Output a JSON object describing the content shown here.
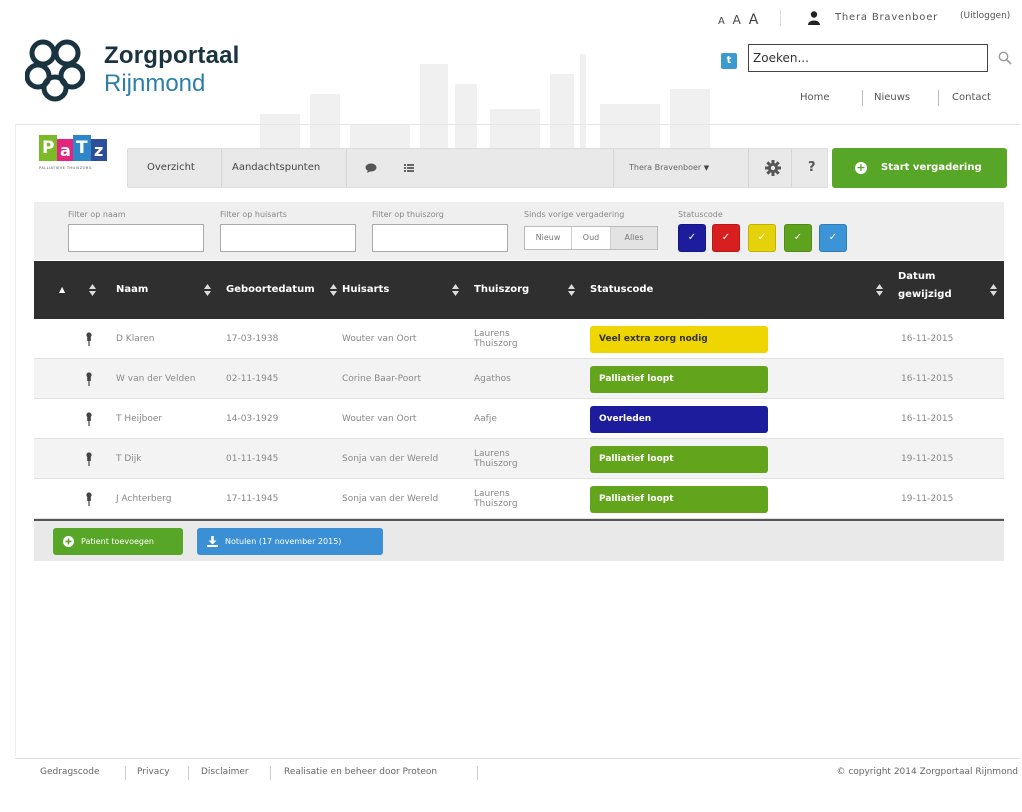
{
  "topbar": {
    "font_sizes": [
      "A",
      "A",
      "A"
    ],
    "user_name": "Thera Bravenboer",
    "logout": "(Uitloggen)"
  },
  "header": {
    "logo_title": "Zorgportaal",
    "logo_subtitle": "Rijnmond",
    "twitter_glyph": "t",
    "search_placeholder": "Zoeken...",
    "nav": [
      "Home",
      "Nieuws",
      "Contact"
    ]
  },
  "patz": {
    "letters": [
      "P",
      "a",
      "T",
      "z"
    ],
    "tagline": "PALLIATIEVE THUISZORG"
  },
  "toolbar": {
    "tabs": [
      "Overzicht",
      "Aandachtspunten"
    ],
    "user_menu": "Thera Bravenboer",
    "help": "?",
    "start_button": "Start vergadering"
  },
  "filters": {
    "name_label": "Filter op naam",
    "gp_label": "Filter op huisarts",
    "homecare_label": "Filter op thuiszorg",
    "since_label": "Sinds vorige vergadering",
    "since_options": [
      "Nieuw",
      "Oud",
      "Alles"
    ],
    "since_selected": "Alles",
    "status_label": "Statuscode",
    "status_colors": [
      "#1c1c9c",
      "#d81e1e",
      "#e4d20a",
      "#5ea31e",
      "#3b93d8"
    ]
  },
  "table": {
    "columns": [
      "Naam",
      "Geboortedatum",
      "Huisarts",
      "Thuiszorg",
      "Statuscode",
      "Datum gewijzigd"
    ],
    "rows": [
      {
        "name": "D Klaren",
        "birth": "17-03-1938",
        "gp": "Wouter van Oort",
        "homecare": "Laurens Thuiszorg",
        "status": "Veel extra zorg nodig",
        "status_color": "#efd600",
        "status_text_color": "#333333",
        "changed": "16-11-2015"
      },
      {
        "name": "W van der Velden",
        "birth": "02-11-1945",
        "gp": "Corine Baar-Poort",
        "homecare": "Agathos",
        "status": "Palliatief loopt",
        "status_color": "#63a41d",
        "status_text_color": "#ffffff",
        "changed": "16-11-2015"
      },
      {
        "name": "T Heijboer",
        "birth": "14-03-1929",
        "gp": "Wouter van Oort",
        "homecare": "Aafje",
        "status": "Overleden",
        "status_color": "#1c1c9c",
        "status_text_color": "#ffffff",
        "changed": "16-11-2015"
      },
      {
        "name": "T Dijk",
        "birth": "01-11-1945",
        "gp": "Sonja van der Wereld",
        "homecare": "Laurens Thuiszorg",
        "status": "Palliatief loopt",
        "status_color": "#63a41d",
        "status_text_color": "#ffffff",
        "changed": "19-11-2015"
      },
      {
        "name": "J Achterberg",
        "birth": "17-11-1945",
        "gp": "Sonja van der Wereld",
        "homecare": "Laurens Thuiszorg",
        "status": "Palliatief loopt",
        "status_color": "#63a41d",
        "status_text_color": "#ffffff",
        "changed": "19-11-2015"
      }
    ]
  },
  "actions": {
    "add_patient": "Patient toevoegen",
    "minutes": "Notulen (17 november 2015)"
  },
  "footer": {
    "links": [
      "Gedragscode",
      "Privacy",
      "Disclaimer",
      "Realisatie en beheer door Proteon"
    ],
    "copyright": "© copyright 2014 Zorgportaal Rijnmond"
  },
  "colors": {
    "accent_green": "#58a627",
    "accent_blue": "#3b8fd4",
    "header_dark": "#2f2f2f",
    "brand_dark": "#1a3340",
    "brand_blue": "#2e7fa8"
  }
}
